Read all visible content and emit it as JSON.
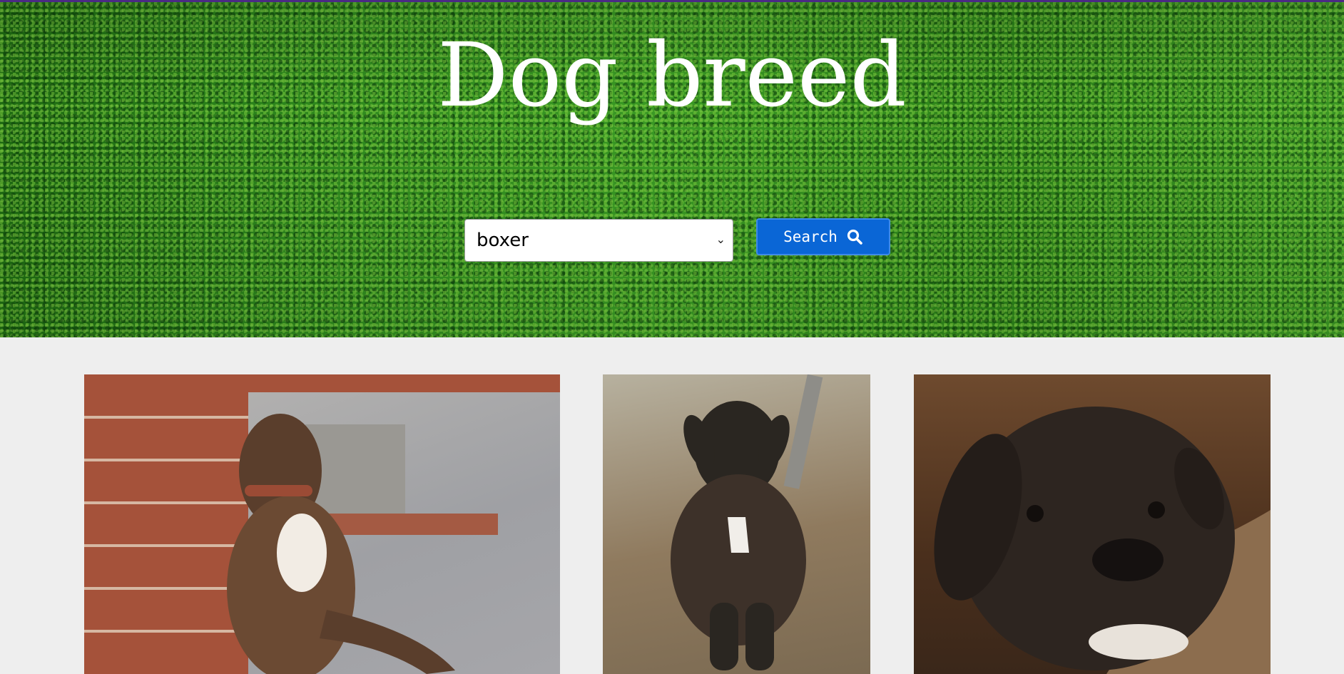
{
  "header": {
    "title": "Dog breed"
  },
  "search": {
    "selected_breed": "boxer",
    "button_label": "Search"
  },
  "gallery": {
    "images": [
      {
        "alt": "boxer"
      },
      {
        "alt": "boxer"
      },
      {
        "alt": "boxer"
      }
    ]
  },
  "colors": {
    "accent": "#0a66d6",
    "page_bg": "#eeeeee",
    "top_strip": "#4b2a84"
  }
}
